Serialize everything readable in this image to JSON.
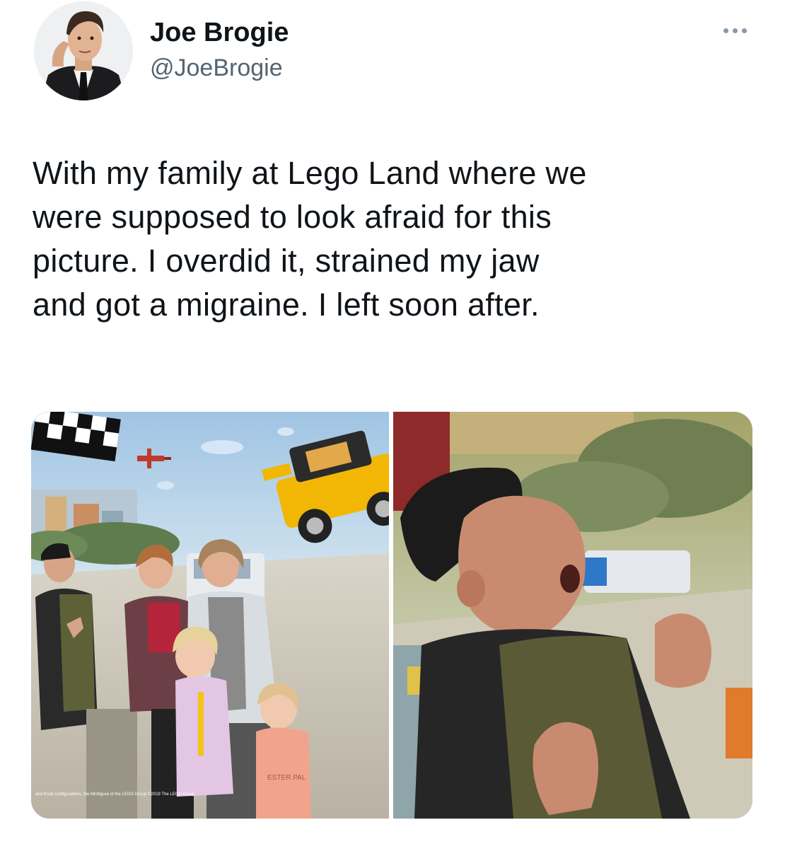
{
  "author": {
    "display_name": "Joe Brogie",
    "handle": "@JoeBrogie"
  },
  "tweet": {
    "text": "With my family at Lego Land where we\nwere supposed to look afraid for this\npicture. I overdid it, strained my jaw\nand got a migraine. I left soon after."
  },
  "media": {
    "photo_count": 2,
    "left_photo_fine_print": "and Knob configurations, the Minifigure of the LEGO Group ©2019 The LEGO Group",
    "left_photo_shirt_text": "ESTER PAL"
  },
  "icons": {
    "more": "more-horizontal-icon"
  },
  "colors": {
    "text_primary": "#0f1419",
    "text_secondary": "#536471",
    "icon_gray": "#8b98a5"
  }
}
